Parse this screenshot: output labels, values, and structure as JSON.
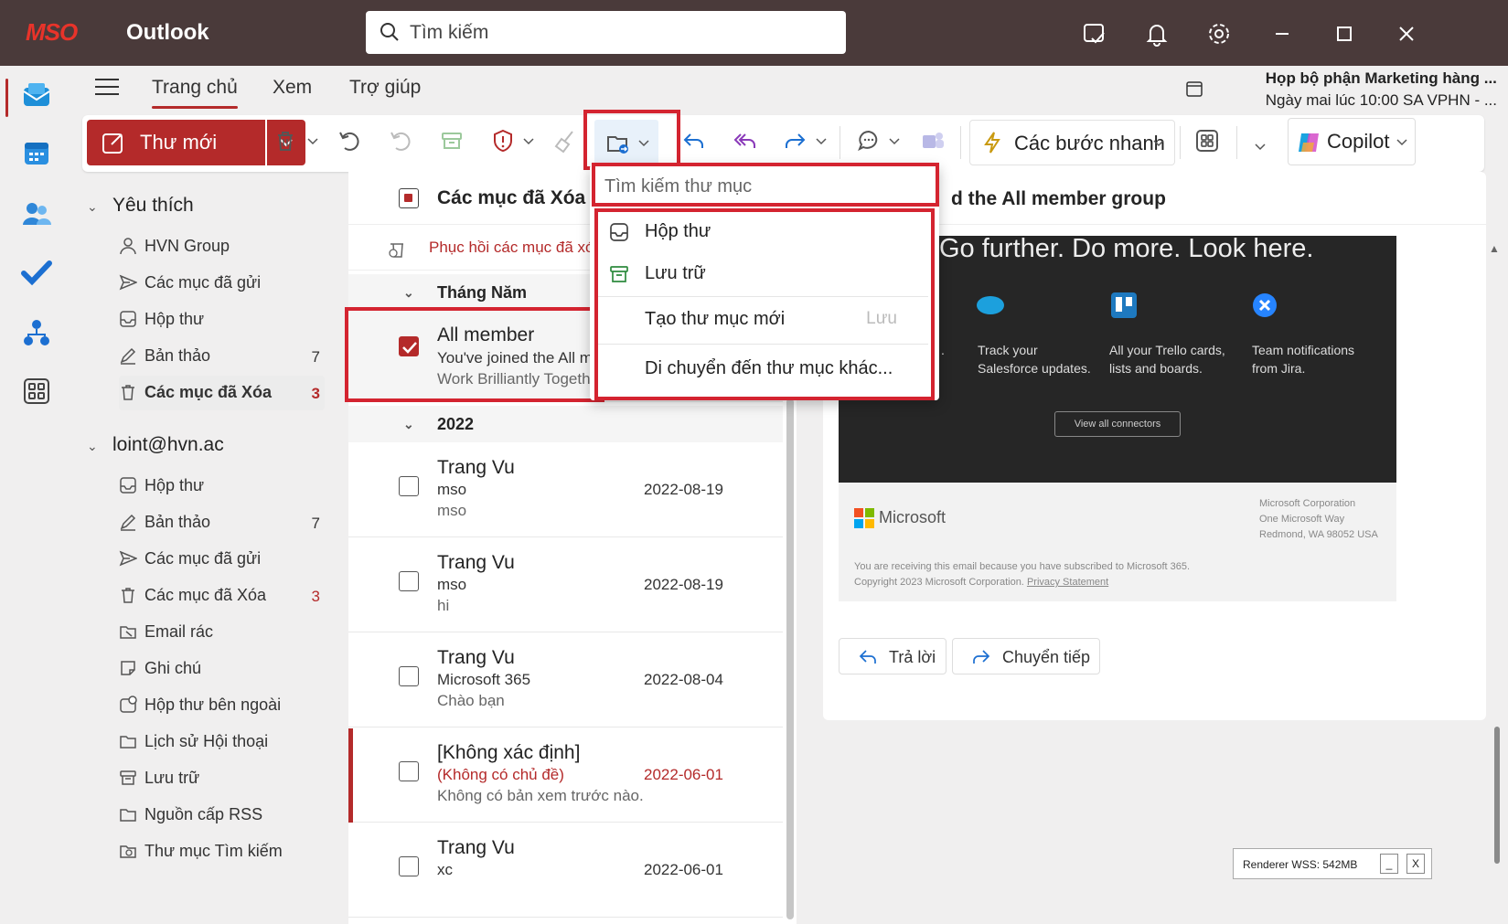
{
  "titlebar": {
    "logo": "MSO",
    "app_name": "Outlook",
    "search_placeholder": "Tìm kiếm"
  },
  "tabs": [
    {
      "label": "Trang chủ"
    },
    {
      "label": "Xem"
    },
    {
      "label": "Trợ giúp"
    }
  ],
  "reminder": {
    "title": "Họp bộ phận Marketing hàng ...",
    "time": "Ngày mai lúc 10:00 SA VPHN - ..."
  },
  "ribbon": {
    "new_mail": "Thư mới",
    "quick_steps": "Các bước nhanh",
    "copilot": "Copilot"
  },
  "folders": {
    "favorites_label": "Yêu thích",
    "favorites": [
      {
        "label": "HVN Group",
        "count": "",
        "icon": "person-icon"
      },
      {
        "label": "Các mục đã gửi",
        "count": "",
        "icon": "send-icon"
      },
      {
        "label": "Hộp thư",
        "count": "",
        "icon": "inbox-icon"
      },
      {
        "label": "Bản thảo",
        "count": "7",
        "icon": "draft-icon"
      },
      {
        "label": "Các mục đã Xóa",
        "count": "3",
        "icon": "trash-icon"
      }
    ],
    "account_label": "loint@hvn.ac",
    "account": [
      {
        "label": "Hộp thư",
        "count": "",
        "icon": "inbox-icon"
      },
      {
        "label": "Bản thảo",
        "count": "7",
        "icon": "draft-icon"
      },
      {
        "label": "Các mục đã gửi",
        "count": "",
        "icon": "send-icon"
      },
      {
        "label": "Các mục đã Xóa",
        "count": "3",
        "icon": "trash-icon"
      },
      {
        "label": "Email rác",
        "count": "",
        "icon": "junk-icon"
      },
      {
        "label": "Ghi chú",
        "count": "",
        "icon": "note-icon"
      },
      {
        "label": "Hộp thư bên ngoài",
        "count": "",
        "icon": "outbox-icon"
      },
      {
        "label": "Lịch sử Hội thoại",
        "count": "",
        "icon": "folder-icon"
      },
      {
        "label": "Lưu trữ",
        "count": "",
        "icon": "archive-icon"
      },
      {
        "label": "Nguồn cấp RSS",
        "count": "",
        "icon": "folder-icon"
      },
      {
        "label": "Thư mục Tìm kiếm",
        "count": "",
        "icon": "search-folder-icon"
      }
    ]
  },
  "message_list": {
    "title": "Các mục đã Xóa",
    "restore_label": "Phục hồi các mục đã xó",
    "section_month": "Tháng Năm",
    "section_year": "2022",
    "selected": {
      "from": "All member",
      "subject": "You've joined the All m",
      "preview": "Work Brilliantly Togeth"
    },
    "messages": [
      {
        "from": "Trang Vu",
        "subject": "mso",
        "preview": "mso",
        "date": "2022-08-19"
      },
      {
        "from": "Trang Vu",
        "subject": "mso",
        "preview": "hi",
        "date": "2022-08-19"
      },
      {
        "from": "Trang Vu",
        "subject": "Microsoft 365",
        "preview": "Chào bạn",
        "date": "2022-08-04"
      },
      {
        "from": "[Không xác định]",
        "subject": "(Không có chủ đề)",
        "preview": "Không có bản xem trước nào.",
        "date": "2022-06-01"
      },
      {
        "from": "Trang Vu",
        "subject": "xc",
        "preview": "",
        "date": "2022-06-01"
      }
    ]
  },
  "reading": {
    "subject": "d the All member group",
    "headline": "Go further. Do more. Look here.",
    "col0": ".",
    "col1_l1": "Track your",
    "col1_l2": "Salesforce updates.",
    "col2_l1": "All your Trello cards,",
    "col2_l2": "lists and boards.",
    "col3_l1": "Team notifications",
    "col3_l2": "from Jira.",
    "view_all": "View all connectors",
    "microsoft": "Microsoft",
    "addr1": "Microsoft Corporation",
    "addr2": "One Microsoft Way",
    "addr3": "Redmond, WA 98052 USA",
    "legal1": "You are receiving this email because you have subscribed to Microsoft 365.",
    "legal2_a": "Copyright 2023 Microsoft Corporation. ",
    "legal2_b": "Privacy Statement",
    "reply": "Trả lời",
    "forward": "Chuyển tiếp"
  },
  "dropdown": {
    "search_placeholder": "Tìm kiếm thư mục",
    "items": [
      {
        "label": "Hộp thư"
      },
      {
        "label": "Lưu trữ"
      },
      {
        "label": "Tạo thư mục mới",
        "shortcut": "Lưu"
      },
      {
        "label": "Di chuyển đến thư mục khác..."
      }
    ]
  },
  "renderer": {
    "label": "Renderer WSS: 542MB",
    "minimize": "_",
    "close": "X"
  },
  "colors": {
    "accent": "#b42a2a",
    "titlebar": "#4a3a3a",
    "highlight_box": "#d42430"
  }
}
